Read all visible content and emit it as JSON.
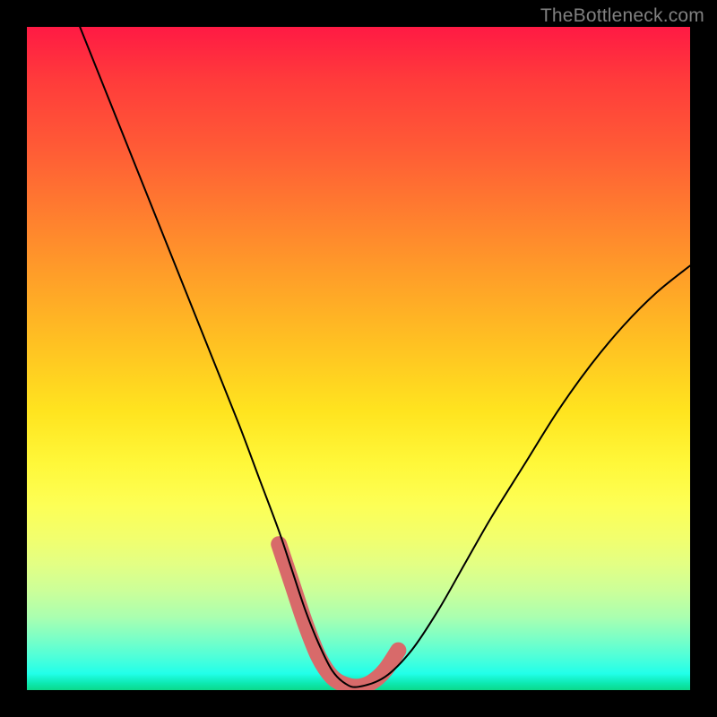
{
  "attribution": "TheBottleneck.com",
  "chart_data": {
    "type": "line",
    "title": "",
    "xlabel": "",
    "ylabel": "",
    "xlim": [
      0,
      100
    ],
    "ylim": [
      0,
      100
    ],
    "gradient_stops": [
      {
        "pct": 0,
        "color": "#ff1a44"
      },
      {
        "pct": 8,
        "color": "#ff3b3b"
      },
      {
        "pct": 18,
        "color": "#ff5a36"
      },
      {
        "pct": 28,
        "color": "#ff7d2f"
      },
      {
        "pct": 38,
        "color": "#ffa028"
      },
      {
        "pct": 48,
        "color": "#ffc222"
      },
      {
        "pct": 58,
        "color": "#ffe41f"
      },
      {
        "pct": 66,
        "color": "#fff83a"
      },
      {
        "pct": 72,
        "color": "#fdff55"
      },
      {
        "pct": 77,
        "color": "#f2ff6d"
      },
      {
        "pct": 81,
        "color": "#e3ff84"
      },
      {
        "pct": 85,
        "color": "#ccff99"
      },
      {
        "pct": 89,
        "color": "#aaffb0"
      },
      {
        "pct": 92,
        "color": "#7effc5"
      },
      {
        "pct": 95,
        "color": "#4effd9"
      },
      {
        "pct": 97.5,
        "color": "#22ffe9"
      },
      {
        "pct": 99,
        "color": "#0de8b0"
      },
      {
        "pct": 100,
        "color": "#0cd88a"
      }
    ],
    "series": [
      {
        "name": "bottleneck-curve",
        "color": "#000000",
        "stroke_width": 2,
        "x": [
          8,
          12,
          16,
          20,
          24,
          28,
          32,
          35,
          38,
          40,
          42,
          44,
          46,
          48,
          50,
          54,
          58,
          62,
          66,
          70,
          75,
          80,
          85,
          90,
          95,
          100
        ],
        "y": [
          100,
          90,
          80,
          70,
          60,
          50,
          40,
          32,
          24,
          18,
          12,
          7,
          3,
          1,
          0.5,
          2,
          6,
          12,
          19,
          26,
          34,
          42,
          49,
          55,
          60,
          64
        ]
      }
    ],
    "highlight_segment": {
      "color": "#d86a6a",
      "stroke_width": 18,
      "x": [
        38,
        40,
        42,
        44,
        46,
        48,
        50,
        52,
        54,
        56
      ],
      "y": [
        22,
        16,
        10,
        5,
        2,
        0.8,
        0.5,
        1.2,
        3,
        6
      ]
    }
  }
}
